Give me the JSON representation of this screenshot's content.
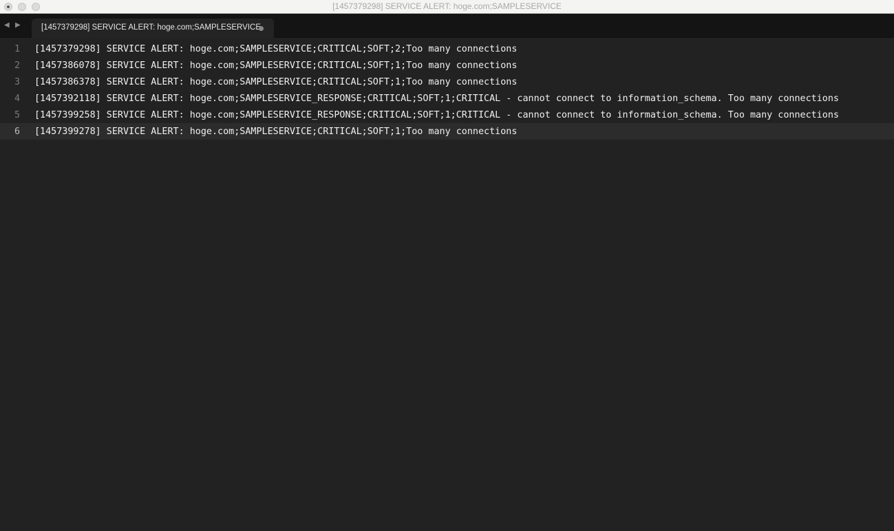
{
  "window": {
    "title": "[1457379298] SERVICE ALERT: hoge.com;SAMPLESERVICE"
  },
  "tab": {
    "label": "[1457379298] SERVICE ALERT: hoge.com;SAMPLESERVICE"
  },
  "nav": {
    "back": "◀",
    "forward": "▶"
  },
  "lines": [
    {
      "n": "1",
      "text": "[1457379298] SERVICE ALERT: hoge.com;SAMPLESERVICE;CRITICAL;SOFT;2;Too many connections"
    },
    {
      "n": "2",
      "text": "[1457386078] SERVICE ALERT: hoge.com;SAMPLESERVICE;CRITICAL;SOFT;1;Too many connections"
    },
    {
      "n": "3",
      "text": "[1457386378] SERVICE ALERT: hoge.com;SAMPLESERVICE;CRITICAL;SOFT;1;Too many connections"
    },
    {
      "n": "4",
      "text": "[1457392118] SERVICE ALERT: hoge.com;SAMPLESERVICE_RESPONSE;CRITICAL;SOFT;1;CRITICAL - cannot connect to information_schema. Too many connections"
    },
    {
      "n": "5",
      "text": "[1457399258] SERVICE ALERT: hoge.com;SAMPLESERVICE_RESPONSE;CRITICAL;SOFT;1;CRITICAL - cannot connect to information_schema. Too many connections"
    },
    {
      "n": "6",
      "text": "[1457399278] SERVICE ALERT: hoge.com;SAMPLESERVICE;CRITICAL;SOFT;1;Too many connections"
    }
  ]
}
